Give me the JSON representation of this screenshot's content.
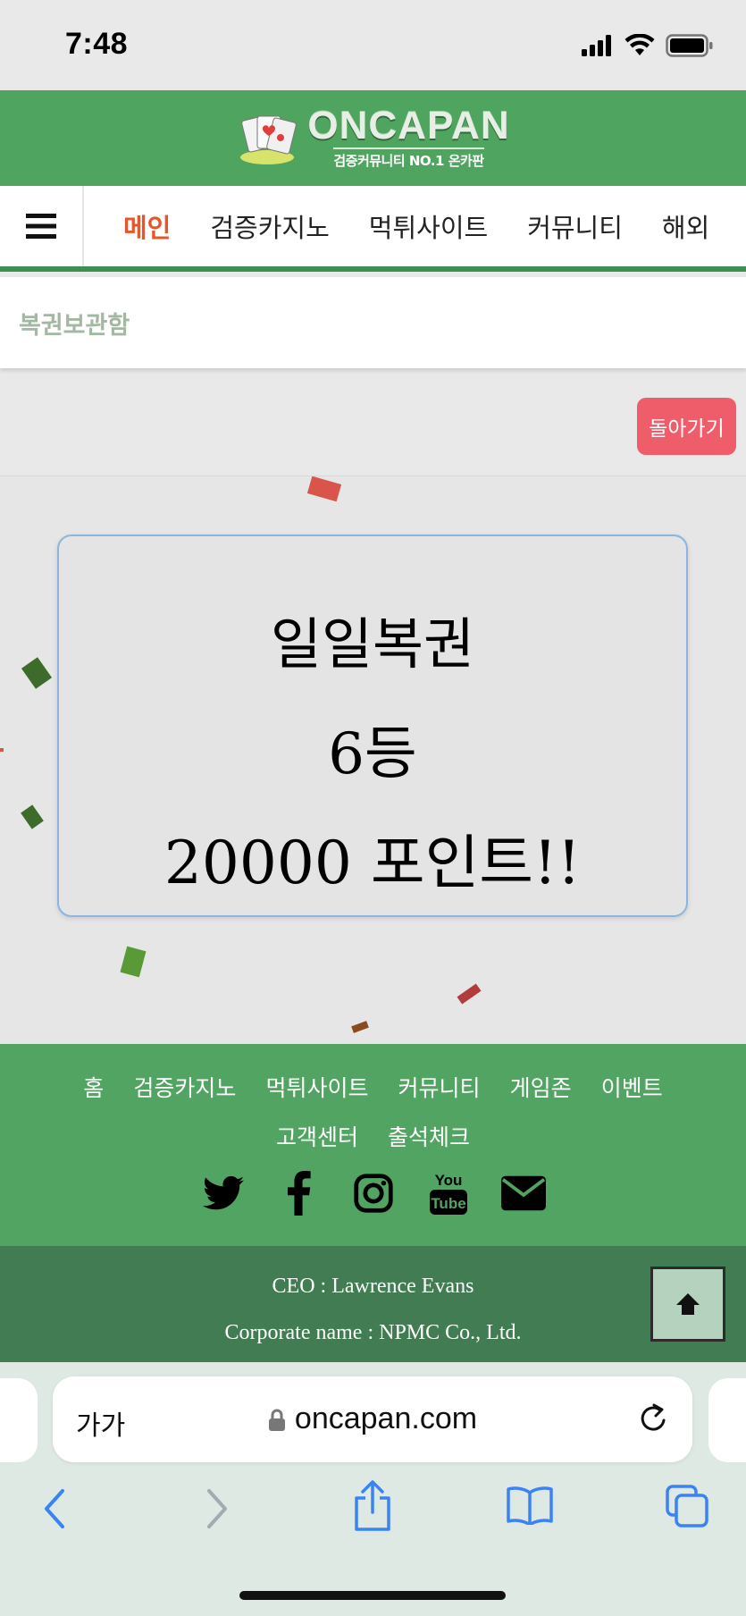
{
  "status_bar": {
    "time": "7:48"
  },
  "header": {
    "logo_text": "ONCAPAN",
    "logo_subtitle": "검증커뮤니티 NO.1 온카판"
  },
  "nav": {
    "items": [
      {
        "label": "메인",
        "active": true
      },
      {
        "label": "검증카지노"
      },
      {
        "label": "먹튀사이트"
      },
      {
        "label": "커뮤니티"
      },
      {
        "label": "해외"
      }
    ]
  },
  "breadcrumb": "복권보관함",
  "back_button": "돌아가기",
  "prize": {
    "title": "일일복권",
    "rank": "6등",
    "points": "20000 포인트!!"
  },
  "footer": {
    "links": [
      "홈",
      "검증카지노",
      "먹튀사이트",
      "커뮤니티",
      "게임존",
      "이벤트",
      "고객센터",
      "출석체크"
    ],
    "social_icons": [
      "twitter-icon",
      "facebook-icon",
      "instagram-icon",
      "youtube-icon",
      "email-icon"
    ],
    "ceo": "CEO : Lawrence Evans",
    "corporate": "Corporate name : NPMC Co., Ltd."
  },
  "browser": {
    "aa_label": "가가",
    "url": "oncapan.com"
  },
  "colors": {
    "header_green": "#4fa45f",
    "footer_dark_green": "#427c52",
    "nav_active": "#e5572b",
    "back_button": "#ef5d6b",
    "ios_blue": "#3b82f6"
  }
}
